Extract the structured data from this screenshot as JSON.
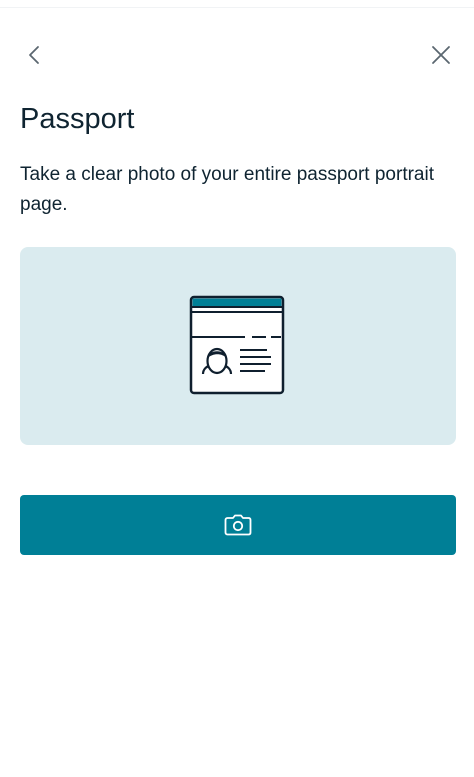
{
  "header": {
    "back_icon": "chevron-left-icon",
    "close_icon": "close-icon"
  },
  "page": {
    "title": "Passport",
    "instructions": "Take a clear photo of your entire passport portrait page."
  },
  "illustration": {
    "icon": "passport-portrait-page-icon",
    "background_color": "#daebef",
    "accent_color": "#007f96"
  },
  "capture_button": {
    "icon": "camera-icon",
    "color": "#007f96"
  }
}
